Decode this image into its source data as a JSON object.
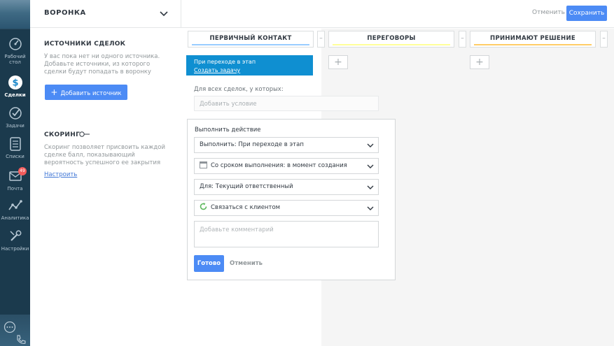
{
  "nav": {
    "items": [
      {
        "label": "Рабочий стол",
        "icon": "dashboard-icon"
      },
      {
        "label": "Сделки",
        "icon": "deals-icon"
      },
      {
        "label": "Задачи",
        "icon": "tasks-icon"
      },
      {
        "label": "Списки",
        "icon": "lists-icon"
      },
      {
        "label": "Почта",
        "icon": "mail-icon",
        "badge": "49"
      },
      {
        "label": "Аналитика",
        "icon": "analytics-icon"
      },
      {
        "label": "Настройки",
        "icon": "settings-icon"
      }
    ]
  },
  "header": {
    "title": "ВОРОНКА",
    "cancel_label": "Отменить",
    "save_label": "Сохранить"
  },
  "sources": {
    "title": "ИСТОЧНИКИ СДЕЛОК",
    "description": "У вас пока нет ни одного источника. Добавьте источники, из которого сделки будут попадать в воронку",
    "add_button": "Добавить источник"
  },
  "scoring": {
    "title": "СКОРИНГ",
    "description": "Скоринг позволяет присвоить каждой сделке балл, показывающий вероятность успешного ее закрытия",
    "link": "Настроить"
  },
  "stages": [
    {
      "name": "ПЕРВИЧНЫЙ КОНТАКТ",
      "color": "#99ccff"
    },
    {
      "name": "ПЕРЕГОВОРЫ",
      "color": "#ffff99"
    },
    {
      "name": "ПРИНИМАЮТ РЕШЕНИЕ",
      "color": "#ffcc66"
    }
  ],
  "trigger": {
    "title": "При переходе в этап",
    "link": "Создать задачу"
  },
  "condition": {
    "label": "Для всех сделок, у которых:",
    "placeholder": "Добавить условие"
  },
  "action_panel": {
    "title": "Выполнить действие",
    "selects": [
      "Выполнить: При переходе в этап",
      "Со сроком выполнения: в момент создания",
      "Для: Текущий ответственный",
      "Связаться с клиентом"
    ],
    "comment_placeholder": "Добавьте комментарий",
    "done_label": "Готово",
    "cancel_label": "Отменить"
  },
  "colors": {
    "accent": "#4c8bf5",
    "trigger": "#0f8fd1",
    "nav_bg": "#1b3a4d"
  }
}
